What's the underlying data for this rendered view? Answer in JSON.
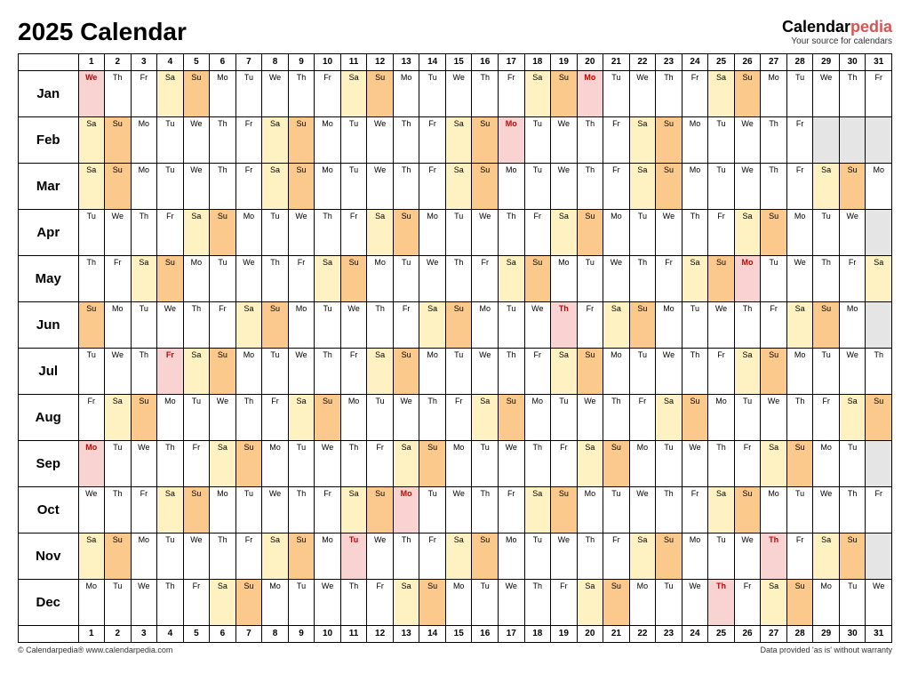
{
  "title": "2025 Calendar",
  "brand": {
    "name1": "Calendar",
    "name2": "pedia",
    "tag": "Your source for calendars"
  },
  "footer": {
    "left": "© Calendarpedia®   www.calendarpedia.com",
    "right": "Data provided 'as is' without warranty"
  },
  "dayNumbers": [
    1,
    2,
    3,
    4,
    5,
    6,
    7,
    8,
    9,
    10,
    11,
    12,
    13,
    14,
    15,
    16,
    17,
    18,
    19,
    20,
    21,
    22,
    23,
    24,
    25,
    26,
    27,
    28,
    29,
    30,
    31
  ],
  "dow": [
    "Su",
    "Mo",
    "Tu",
    "We",
    "Th",
    "Fr",
    "Sa"
  ],
  "months": [
    {
      "name": "Jan",
      "start": 3,
      "len": 31,
      "holidays": [
        1,
        20
      ]
    },
    {
      "name": "Feb",
      "start": 6,
      "len": 28,
      "holidays": [
        17
      ]
    },
    {
      "name": "Mar",
      "start": 6,
      "len": 31,
      "holidays": []
    },
    {
      "name": "Apr",
      "start": 2,
      "len": 30,
      "holidays": []
    },
    {
      "name": "May",
      "start": 4,
      "len": 31,
      "holidays": [
        26
      ]
    },
    {
      "name": "Jun",
      "start": 0,
      "len": 30,
      "holidays": [
        19
      ]
    },
    {
      "name": "Jul",
      "start": 2,
      "len": 31,
      "holidays": [
        4
      ]
    },
    {
      "name": "Aug",
      "start": 5,
      "len": 31,
      "holidays": []
    },
    {
      "name": "Sep",
      "start": 1,
      "len": 30,
      "holidays": [
        1
      ]
    },
    {
      "name": "Oct",
      "start": 3,
      "len": 31,
      "holidays": [
        13
      ]
    },
    {
      "name": "Nov",
      "start": 6,
      "len": 30,
      "holidays": [
        11,
        27
      ]
    },
    {
      "name": "Dec",
      "start": 1,
      "len": 31,
      "holidays": [
        25
      ]
    }
  ]
}
